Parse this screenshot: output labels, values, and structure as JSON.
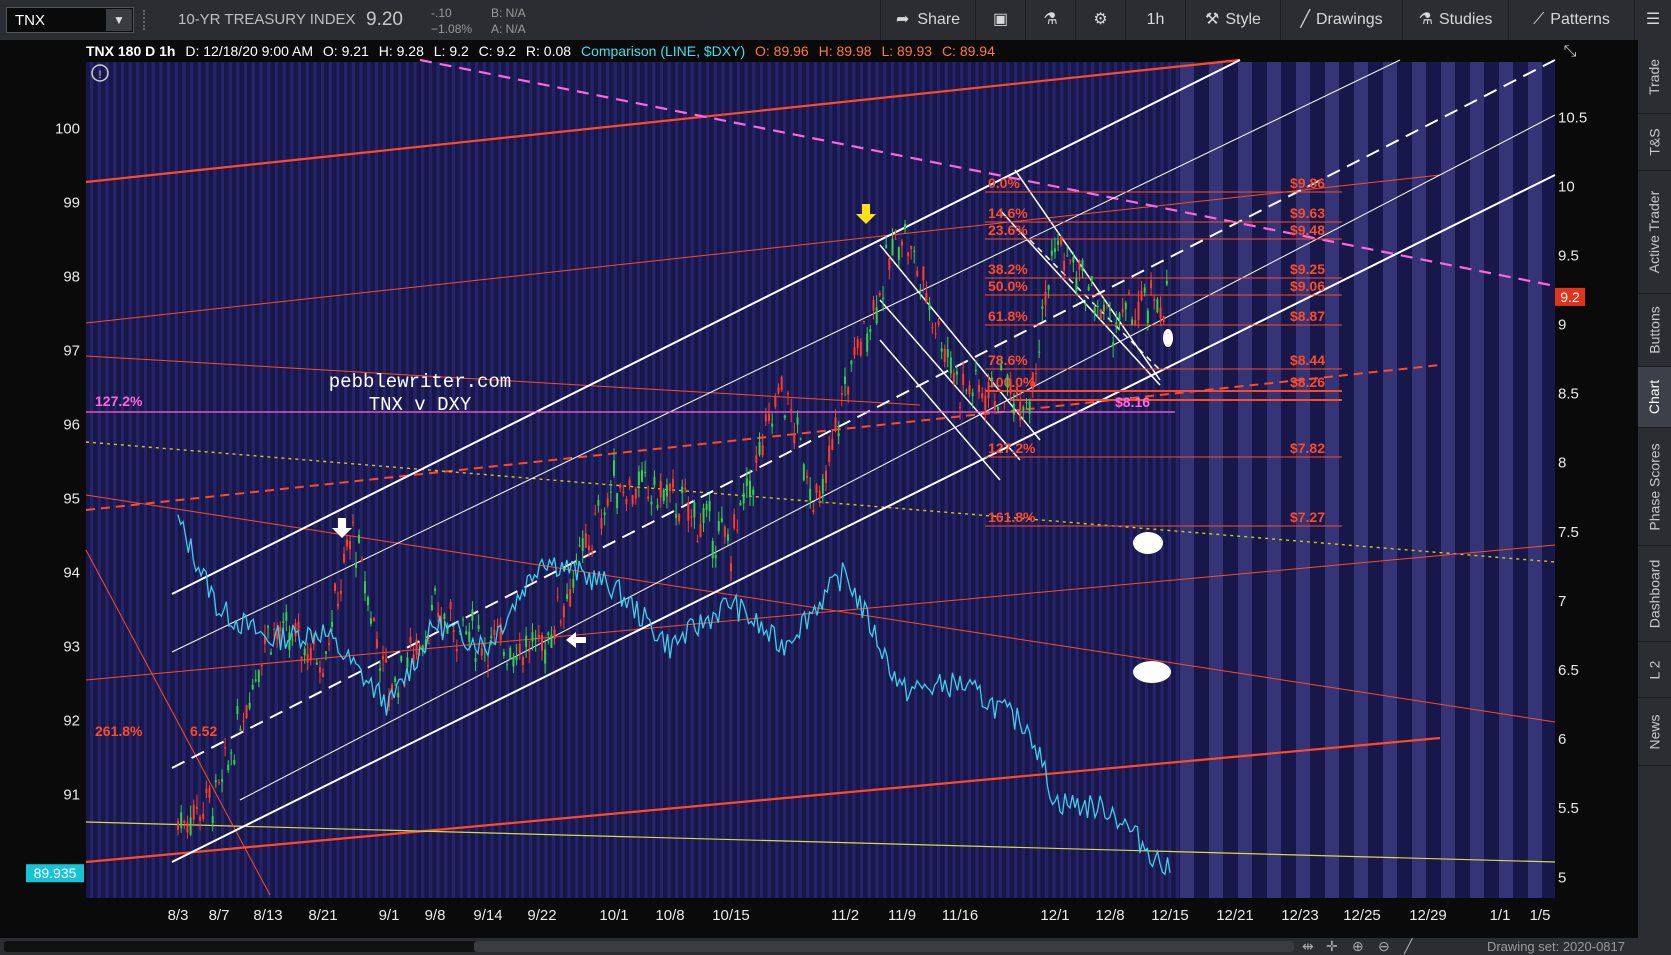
{
  "toolbar": {
    "symbol": "TNX",
    "instrument_title": "10-YR TREASURY INDEX",
    "last_price": "9.20",
    "net_change": "-.10",
    "percent_change": "−1.08%",
    "bid": "B: N/A",
    "ask": "A: N/A",
    "share_label": "Share",
    "timeframe_label": "1h",
    "style_label": "Style",
    "drawings_label": "Drawings",
    "studies_label": "Studies",
    "patterns_label": "Patterns"
  },
  "header": {
    "study_label": "TNX 180 D 1h",
    "date": "D: 12/18/20 9:00 AM",
    "open": "O: 9.21",
    "high": "H: 9.28",
    "low": "L: 9.2",
    "close": "C: 9.2",
    "range": "R: 0.08",
    "comparison_label": "Comparison (LINE, $DXY)",
    "cmp_open": "O: 89.96",
    "cmp_high": "H: 89.98",
    "cmp_low": "L: 89.93",
    "cmp_close": "C: 89.94"
  },
  "right_tabs": [
    "Trade",
    "T&S",
    "Active Trader",
    "Buttons",
    "Chart",
    "Phase Scores",
    "Dashboard",
    "L 2",
    "News"
  ],
  "active_tab": "Chart",
  "bottom": {
    "drawing_set": "Drawing set: 2020-0817"
  },
  "annotations": {
    "site": "pebblewriter.com",
    "subtitle": "TNX v DXY",
    "left_fib_127": "127.2%",
    "left_fib_261": "261.8%",
    "left_value_652": "6.52",
    "fib_target_816": "$8.16"
  },
  "fib_levels": [
    {
      "pct": "0.0%",
      "price": "$9.86"
    },
    {
      "pct": "14.6%",
      "price": "$9.63"
    },
    {
      "pct": "23.6%",
      "price": "$9.48"
    },
    {
      "pct": "38.2%",
      "price": "$9.25"
    },
    {
      "pct": "50.0%",
      "price": "$9.06"
    },
    {
      "pct": "61.8%",
      "price": "$8.87"
    },
    {
      "pct": "78.6%",
      "price": "$8.44"
    },
    {
      "pct": "100.0%",
      "price": "$8.26"
    },
    {
      "pct": "127.2%",
      "price": "$7.82"
    },
    {
      "pct": "161.8%",
      "price": "$7.27"
    }
  ],
  "colors": {
    "background": "#18174a",
    "stripe": "#2a2a74",
    "dxy_line": "#3fd0e8",
    "fib_text": "#ff4a2a",
    "channel": "#ffffff",
    "magenta_line": "#ff66dd",
    "price_tag": "#e0341b",
    "cmp_tag": "#17c4d6"
  },
  "chart_data": {
    "type": "line",
    "title": "TNX 180 D 1h",
    "x_tick_labels": [
      "8/3",
      "8/7",
      "8/13",
      "8/21",
      "9/1",
      "9/8",
      "9/14",
      "9/22",
      "10/1",
      "10/8",
      "10/15",
      "11/2",
      "11/9",
      "11/16",
      "12/1",
      "12/8",
      "12/15",
      "12/21",
      "12/23",
      "12/25",
      "12/29",
      "1/1",
      "1/5"
    ],
    "x_ticks": [
      {
        "label": "8/3",
        "date": "2020-08-03"
      },
      {
        "label": "8/7",
        "date": "2020-08-07"
      },
      {
        "label": "8/13",
        "date": "2020-08-13"
      },
      {
        "label": "8/21",
        "date": "2020-08-21"
      },
      {
        "label": "9/1",
        "date": "2020-09-01"
      },
      {
        "label": "9/8",
        "date": "2020-09-08"
      },
      {
        "label": "9/14",
        "date": "2020-09-14"
      },
      {
        "label": "9/22",
        "date": "2020-09-22"
      },
      {
        "label": "10/1",
        "date": "2020-10-01"
      },
      {
        "label": "10/8",
        "date": "2020-10-08"
      },
      {
        "label": "10/15",
        "date": "2020-10-15"
      },
      {
        "label": "11/2",
        "date": "2020-11-02"
      },
      {
        "label": "11/9",
        "date": "2020-11-09"
      },
      {
        "label": "11/16",
        "date": "2020-11-16"
      },
      {
        "label": "12/1",
        "date": "2020-12-01"
      },
      {
        "label": "12/8",
        "date": "2020-12-08"
      },
      {
        "label": "12/15",
        "date": "2020-12-15"
      },
      {
        "label": "12/21",
        "date": "2020-12-21"
      },
      {
        "label": "12/23",
        "date": "2020-12-23"
      },
      {
        "label": "12/25",
        "date": "2020-12-25"
      },
      {
        "label": "12/29",
        "date": "2020-12-29"
      },
      {
        "label": "1/1",
        "date": "2021-01-01"
      },
      {
        "label": "1/5",
        "date": "2021-01-05"
      }
    ],
    "left_axis": {
      "label": "",
      "ticks": [
        "100",
        "99",
        "98",
        "97",
        "96",
        "95",
        "94",
        "93",
        "92",
        "91"
      ],
      "ylim": [
        89.6,
        100.9
      ]
    },
    "right_axis": {
      "label": "",
      "ticks": [
        "10.5",
        "10",
        "9.5",
        "9",
        "8.5",
        "8",
        "7.5",
        "7",
        "6.5",
        "6",
        "5.5",
        "5"
      ],
      "ylim": [
        4.85,
        10.9
      ]
    },
    "price_tag": "9.2",
    "comparison_tag": "89.935",
    "series": [
      {
        "name": "TNX",
        "axis": "right",
        "style": "hourly candles",
        "points": [
          {
            "date": "2020-08-03",
            "value": 5.4
          },
          {
            "date": "2020-08-07",
            "value": 5.6
          },
          {
            "date": "2020-08-13",
            "value": 6.8
          },
          {
            "date": "2020-08-21",
            "value": 6.6
          },
          {
            "date": "2020-08-26",
            "value": 7.5
          },
          {
            "date": "2020-09-01",
            "value": 6.35
          },
          {
            "date": "2020-09-08",
            "value": 6.9
          },
          {
            "date": "2020-09-14",
            "value": 6.7
          },
          {
            "date": "2020-09-22",
            "value": 6.65
          },
          {
            "date": "2020-10-01",
            "value": 7.85
          },
          {
            "date": "2020-10-08",
            "value": 7.75
          },
          {
            "date": "2020-10-15",
            "value": 7.4
          },
          {
            "date": "2020-10-23",
            "value": 8.55
          },
          {
            "date": "2020-10-29",
            "value": 7.65
          },
          {
            "date": "2020-11-02",
            "value": 8.55
          },
          {
            "date": "2020-11-09",
            "value": 9.7
          },
          {
            "date": "2020-11-16",
            "value": 8.55
          },
          {
            "date": "2020-11-27",
            "value": 8.5
          },
          {
            "date": "2020-12-01",
            "value": 9.6
          },
          {
            "date": "2020-12-08",
            "value": 9.0
          },
          {
            "date": "2020-12-15",
            "value": 9.2
          }
        ]
      },
      {
        "name": "$DXY",
        "axis": "left",
        "style": "line",
        "points": [
          {
            "date": "2020-08-03",
            "value": 94.7
          },
          {
            "date": "2020-08-07",
            "value": 93.5
          },
          {
            "date": "2020-08-13",
            "value": 93.1
          },
          {
            "date": "2020-08-21",
            "value": 93.2
          },
          {
            "date": "2020-09-01",
            "value": 92.2
          },
          {
            "date": "2020-09-08",
            "value": 93.3
          },
          {
            "date": "2020-09-14",
            "value": 93.0
          },
          {
            "date": "2020-09-22",
            "value": 94.2
          },
          {
            "date": "2020-10-01",
            "value": 93.8
          },
          {
            "date": "2020-10-08",
            "value": 93.0
          },
          {
            "date": "2020-10-15",
            "value": 93.6
          },
          {
            "date": "2020-10-23",
            "value": 93.0
          },
          {
            "date": "2020-11-02",
            "value": 94.0
          },
          {
            "date": "2020-11-09",
            "value": 92.4
          },
          {
            "date": "2020-11-16",
            "value": 92.5
          },
          {
            "date": "2020-11-27",
            "value": 91.9
          },
          {
            "date": "2020-12-01",
            "value": 90.9
          },
          {
            "date": "2020-12-08",
            "value": 90.8
          },
          {
            "date": "2020-12-15",
            "value": 89.94
          }
        ]
      }
    ]
  }
}
